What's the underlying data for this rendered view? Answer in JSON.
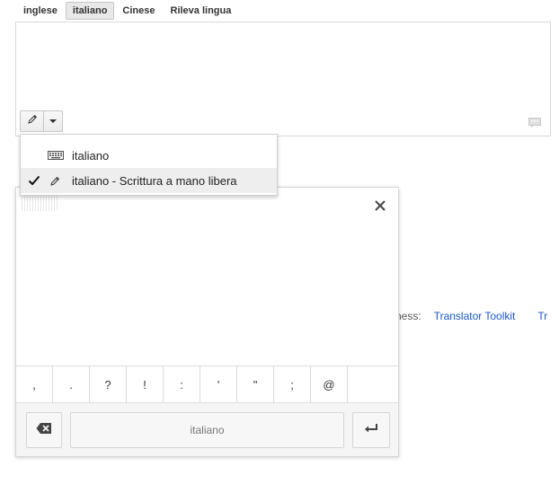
{
  "languages": {
    "tabs": [
      {
        "label": "inglese",
        "active": false
      },
      {
        "label": "italiano",
        "active": true
      },
      {
        "label": "Cinese",
        "active": false
      },
      {
        "label": "Rileva lingua",
        "active": false
      }
    ]
  },
  "source": {
    "text": ""
  },
  "input_tools": {
    "current_tool": "pencil-icon",
    "menu": [
      {
        "label": "italiano",
        "icon": "keyboard-icon",
        "selected": false
      },
      {
        "label": "italiano - Scrittura a mano libera",
        "icon": "pencil-icon",
        "selected": true
      }
    ]
  },
  "background": {
    "business_label": "ness:",
    "links": [
      "Translator Toolkit",
      "Tr"
    ]
  },
  "handwriting": {
    "punctuation": [
      ",",
      ".",
      "?",
      "!",
      ":",
      "'",
      "\"",
      ";",
      "@"
    ],
    "space_label": "italiano"
  },
  "colors": {
    "link": "#1a56c8",
    "selected_menu_bg": "#eeeeee"
  }
}
